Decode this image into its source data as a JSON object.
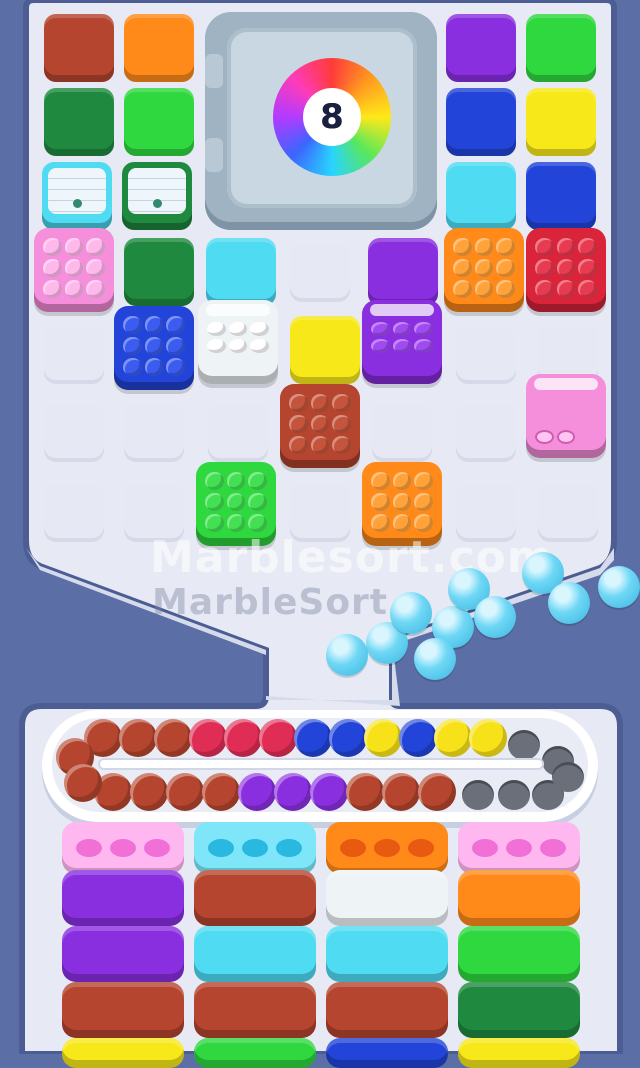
{
  "colors": {
    "brown": "#b5452f",
    "orange": "#ff8a1a",
    "darkgreen": "#1f8a3f",
    "green": "#2fd83f",
    "purple": "#8a2fe0",
    "blue": "#2244d8",
    "yellow": "#f7e81a",
    "cyan": "#4fdcf2",
    "pink": "#f58fdc",
    "red": "#d9243a",
    "white": "#eef3f6",
    "brown_dark": "#a33a28",
    "cream": "#f2f4f2",
    "empty": "#e6e9f3"
  },
  "vault": {
    "icon": "rainbow-dial-safe",
    "counter": "8"
  },
  "watermarks": {
    "primary": "Marblesort.com",
    "secondary": "MarbleSort."
  },
  "board_tiles": [
    {
      "state": "solid",
      "color": "brown"
    },
    {
      "state": "solid",
      "color": "orange"
    },
    {
      "state": "solid",
      "color": "purple"
    },
    {
      "state": "solid",
      "color": "green"
    },
    {
      "state": "solid",
      "color": "darkgreen"
    },
    {
      "state": "solid",
      "color": "green"
    },
    {
      "state": "solid",
      "color": "blue"
    },
    {
      "state": "solid",
      "color": "yellow"
    },
    {
      "state": "lidded",
      "color": "cyan"
    },
    {
      "state": "lidded",
      "color": "darkgreen"
    },
    {
      "state": "solid",
      "color": "cyan"
    },
    {
      "state": "solid",
      "color": "blue"
    }
  ],
  "trays": [
    {
      "color": "pink",
      "marbles": 9
    },
    {
      "color": "orange",
      "marbles": 9
    },
    {
      "color": "red",
      "marbles": 9
    },
    {
      "color": "blue",
      "marbles": 9
    },
    {
      "color": "white",
      "marbles": 6
    },
    {
      "color": "purple",
      "marbles": 6
    },
    {
      "color": "brown",
      "marbles": 9
    },
    {
      "color": "pink",
      "marbles": 2
    },
    {
      "color": "green",
      "marbles": 9
    },
    {
      "color": "orange",
      "marbles": 9
    }
  ],
  "belt_marbles": {
    "top_row": [
      "brown",
      "brown",
      "brown",
      "red",
      "red",
      "red",
      "blue",
      "blue",
      "yellow",
      "blue",
      "yellow",
      "yellow"
    ],
    "bottom_row": [
      "brown",
      "brown",
      "brown",
      "brown",
      "purple",
      "purple",
      "purple",
      "brown",
      "brown",
      "brown"
    ],
    "empty_slots": 6
  },
  "loose_marbles": {
    "color": "cyan",
    "count": 10
  },
  "boxes": {
    "tops": [
      "pink",
      "cyan",
      "orange",
      "pink"
    ],
    "columns": [
      [
        "purple",
        "purple",
        "brown",
        "yellow"
      ],
      [
        "brown",
        "cyan",
        "brown",
        "green"
      ],
      [
        "white",
        "cyan",
        "brown",
        "blue"
      ],
      [
        "orange",
        "green",
        "darkgreen",
        "yellow"
      ]
    ]
  }
}
